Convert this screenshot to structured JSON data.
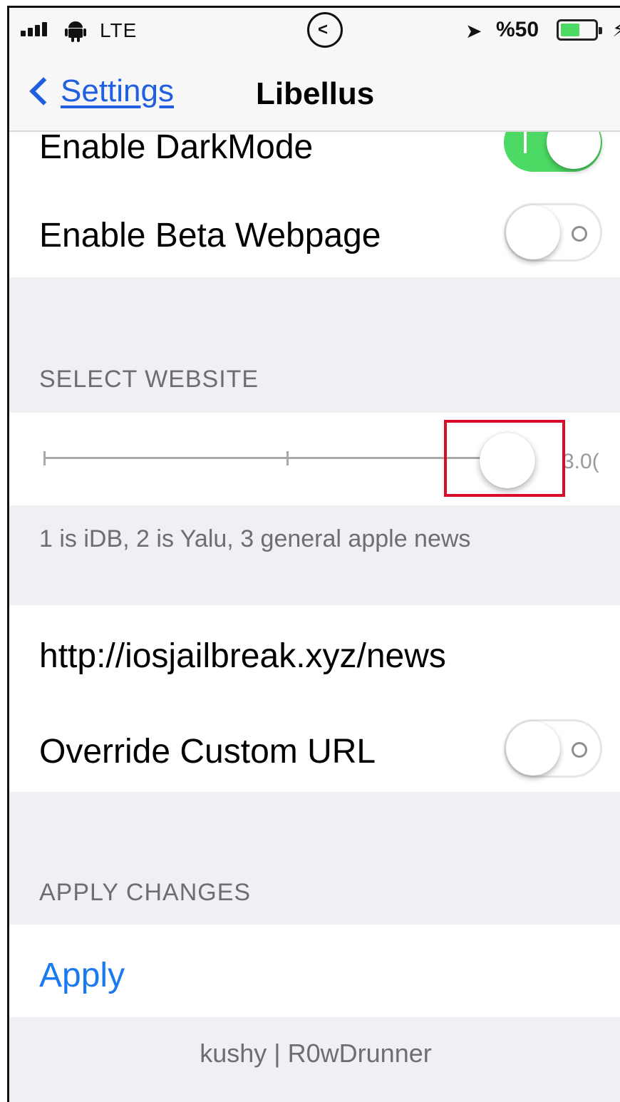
{
  "status_bar": {
    "network": "LTE",
    "clock_glyph": "<",
    "battery_text": "%50",
    "location_glyph": "➤",
    "bolt_glyph": "⚡"
  },
  "nav": {
    "back_label": "Settings",
    "title": "Libellus"
  },
  "rows": {
    "dark_mode": {
      "label": "Enable DarkMode",
      "on": true
    },
    "beta_webpage": {
      "label": "Enable Beta Webpage",
      "on": false
    }
  },
  "select_website": {
    "header": "SELECT WEBSITE",
    "slider_value_text": "3.0(",
    "slider_min": 1,
    "slider_max": 3,
    "slider_value": 3,
    "footer": "1 is iDB, 2 is Yalu, 3 general apple news"
  },
  "url_section": {
    "url_text": "http://iosjailbreak.xyz/news",
    "override_label": "Override Custom URL",
    "override_on": false
  },
  "apply_section": {
    "header": "APPLY CHANGES",
    "apply_label": "Apply"
  },
  "credits": "kushy | R0wDrunner",
  "colors": {
    "accent_blue": "#1f5fe0",
    "apply_blue": "#1a7af0",
    "toggle_on": "#4cd964",
    "highlight_red": "#d90d2a"
  }
}
